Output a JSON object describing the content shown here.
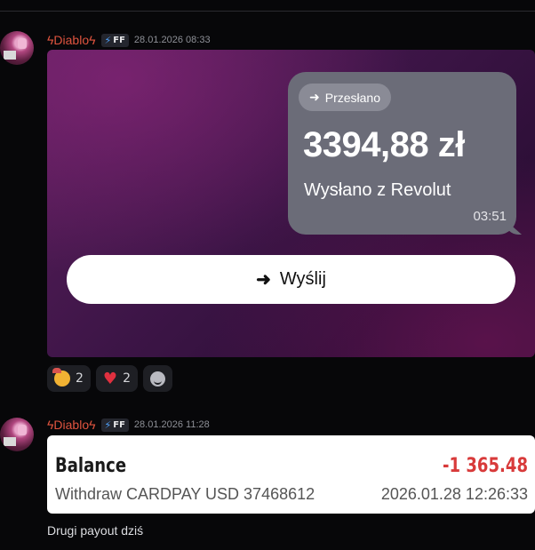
{
  "messages": [
    {
      "username": "ϟDiabloϟ",
      "tag": {
        "icon": "lightning-bolt-icon",
        "label": "FF"
      },
      "timestamp": "28.01.2026 08:33",
      "image": {
        "pill_label": "Przesłano",
        "amount": "3394,88 zł",
        "sent_from": "Wysłano z Revolut",
        "time": "03:51",
        "button_label": "Wyślij"
      },
      "reactions": [
        {
          "emoji": "smiling-face-with-party-hat",
          "count": "2"
        },
        {
          "emoji": "red-heart",
          "count": "2"
        },
        {
          "emoji": "add-reaction-icon",
          "count": ""
        }
      ]
    },
    {
      "username": "ϟDiabloϟ",
      "tag": {
        "icon": "lightning-bolt-icon",
        "label": "FF"
      },
      "timestamp": "28.01.2026 11:28",
      "card": {
        "title": "Balance",
        "amount": "-1 365.48",
        "description": "Withdraw CARDPAY USD 37468612",
        "datetime": "2026.01.28 12:26:33"
      },
      "text": "Drugi payout dziś"
    }
  ],
  "colors": {
    "username": "#e0543f",
    "negative_amount": "#d83a3a",
    "background": "#070709"
  }
}
